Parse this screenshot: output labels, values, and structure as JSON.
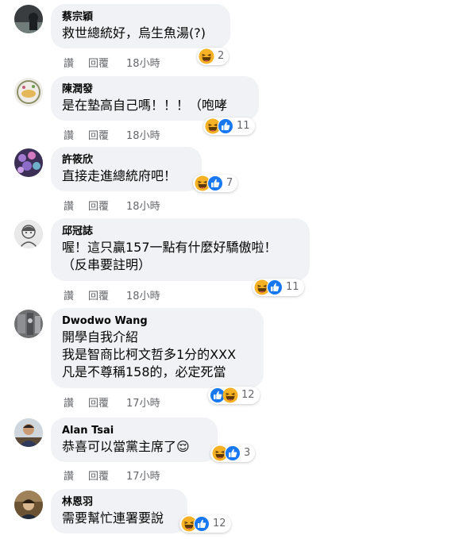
{
  "actions": {
    "like_label": "讚",
    "reply_label": "回覆"
  },
  "colors": {
    "bubble_bg": "#f0f2f5",
    "meta_text": "#65676b",
    "haha_face": "#f7b125",
    "like_blue": "#1877f2"
  },
  "comments": [
    {
      "author": "蔡宗穎",
      "lines": [
        "救世總統好，烏生魚湯(?)"
      ],
      "reactions": {
        "icons": [
          "haha-icon"
        ],
        "count": "2"
      },
      "time": "18小時"
    },
    {
      "author": "陳潤發",
      "lines": [
        "是在墊高自己嗎！！！（咆哮"
      ],
      "reactions": {
        "icons": [
          "haha-icon",
          "like-icon"
        ],
        "count": "11"
      },
      "time": "18小時"
    },
    {
      "author": "許筱欣",
      "lines": [
        "直接走進總統府吧！"
      ],
      "reactions": {
        "icons": [
          "haha-icon",
          "like-icon"
        ],
        "count": "7"
      },
      "time": "18小時"
    },
    {
      "author": "邱冠誌",
      "lines": [
        "喔！這只贏157一點有什麼好驕傲啦！",
        "（反串要註明）"
      ],
      "reactions": {
        "icons": [
          "haha-icon",
          "like-icon"
        ],
        "count": "11"
      },
      "time": "18小時"
    },
    {
      "author": "Dwodwo Wang",
      "lines": [
        "開學自我介紹",
        "我是智商比柯文哲多1分的XXX",
        "凡是不尊稱158的，必定死當"
      ],
      "reactions": {
        "icons": [
          "like-icon",
          "haha-icon"
        ],
        "count": "12"
      },
      "time": "17小時"
    },
    {
      "author": "Alan Tsai",
      "lines": [
        "恭喜可以當黨主席了😌"
      ],
      "reactions": {
        "icons": [
          "haha-icon",
          "like-icon"
        ],
        "count": "3"
      },
      "time": "17小時"
    },
    {
      "author": "林恩羽",
      "lines": [
        "需要幫忙連署要說"
      ],
      "reactions": {
        "icons": [
          "haha-icon",
          "like-icon"
        ],
        "count": "12"
      },
      "time": ""
    }
  ]
}
